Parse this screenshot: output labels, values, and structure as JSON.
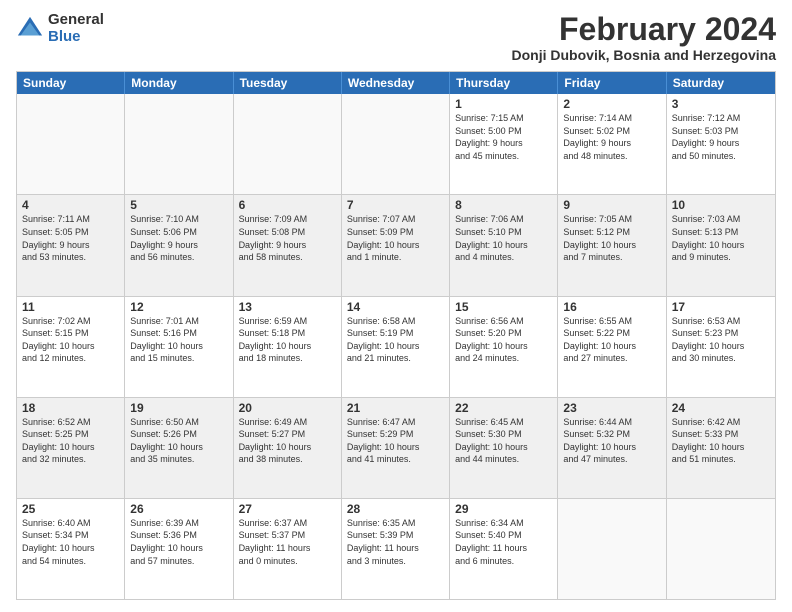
{
  "logo": {
    "general": "General",
    "blue": "Blue"
  },
  "title": "February 2024",
  "subtitle": "Donji Dubovik, Bosnia and Herzegovina",
  "days_of_week": [
    "Sunday",
    "Monday",
    "Tuesday",
    "Wednesday",
    "Thursday",
    "Friday",
    "Saturday"
  ],
  "weeks": [
    [
      {
        "day": "",
        "detail": ""
      },
      {
        "day": "",
        "detail": ""
      },
      {
        "day": "",
        "detail": ""
      },
      {
        "day": "",
        "detail": ""
      },
      {
        "day": "1",
        "detail": "Sunrise: 7:15 AM\nSunset: 5:00 PM\nDaylight: 9 hours\nand 45 minutes."
      },
      {
        "day": "2",
        "detail": "Sunrise: 7:14 AM\nSunset: 5:02 PM\nDaylight: 9 hours\nand 48 minutes."
      },
      {
        "day": "3",
        "detail": "Sunrise: 7:12 AM\nSunset: 5:03 PM\nDaylight: 9 hours\nand 50 minutes."
      }
    ],
    [
      {
        "day": "4",
        "detail": "Sunrise: 7:11 AM\nSunset: 5:05 PM\nDaylight: 9 hours\nand 53 minutes."
      },
      {
        "day": "5",
        "detail": "Sunrise: 7:10 AM\nSunset: 5:06 PM\nDaylight: 9 hours\nand 56 minutes."
      },
      {
        "day": "6",
        "detail": "Sunrise: 7:09 AM\nSunset: 5:08 PM\nDaylight: 9 hours\nand 58 minutes."
      },
      {
        "day": "7",
        "detail": "Sunrise: 7:07 AM\nSunset: 5:09 PM\nDaylight: 10 hours\nand 1 minute."
      },
      {
        "day": "8",
        "detail": "Sunrise: 7:06 AM\nSunset: 5:10 PM\nDaylight: 10 hours\nand 4 minutes."
      },
      {
        "day": "9",
        "detail": "Sunrise: 7:05 AM\nSunset: 5:12 PM\nDaylight: 10 hours\nand 7 minutes."
      },
      {
        "day": "10",
        "detail": "Sunrise: 7:03 AM\nSunset: 5:13 PM\nDaylight: 10 hours\nand 9 minutes."
      }
    ],
    [
      {
        "day": "11",
        "detail": "Sunrise: 7:02 AM\nSunset: 5:15 PM\nDaylight: 10 hours\nand 12 minutes."
      },
      {
        "day": "12",
        "detail": "Sunrise: 7:01 AM\nSunset: 5:16 PM\nDaylight: 10 hours\nand 15 minutes."
      },
      {
        "day": "13",
        "detail": "Sunrise: 6:59 AM\nSunset: 5:18 PM\nDaylight: 10 hours\nand 18 minutes."
      },
      {
        "day": "14",
        "detail": "Sunrise: 6:58 AM\nSunset: 5:19 PM\nDaylight: 10 hours\nand 21 minutes."
      },
      {
        "day": "15",
        "detail": "Sunrise: 6:56 AM\nSunset: 5:20 PM\nDaylight: 10 hours\nand 24 minutes."
      },
      {
        "day": "16",
        "detail": "Sunrise: 6:55 AM\nSunset: 5:22 PM\nDaylight: 10 hours\nand 27 minutes."
      },
      {
        "day": "17",
        "detail": "Sunrise: 6:53 AM\nSunset: 5:23 PM\nDaylight: 10 hours\nand 30 minutes."
      }
    ],
    [
      {
        "day": "18",
        "detail": "Sunrise: 6:52 AM\nSunset: 5:25 PM\nDaylight: 10 hours\nand 32 minutes."
      },
      {
        "day": "19",
        "detail": "Sunrise: 6:50 AM\nSunset: 5:26 PM\nDaylight: 10 hours\nand 35 minutes."
      },
      {
        "day": "20",
        "detail": "Sunrise: 6:49 AM\nSunset: 5:27 PM\nDaylight: 10 hours\nand 38 minutes."
      },
      {
        "day": "21",
        "detail": "Sunrise: 6:47 AM\nSunset: 5:29 PM\nDaylight: 10 hours\nand 41 minutes."
      },
      {
        "day": "22",
        "detail": "Sunrise: 6:45 AM\nSunset: 5:30 PM\nDaylight: 10 hours\nand 44 minutes."
      },
      {
        "day": "23",
        "detail": "Sunrise: 6:44 AM\nSunset: 5:32 PM\nDaylight: 10 hours\nand 47 minutes."
      },
      {
        "day": "24",
        "detail": "Sunrise: 6:42 AM\nSunset: 5:33 PM\nDaylight: 10 hours\nand 51 minutes."
      }
    ],
    [
      {
        "day": "25",
        "detail": "Sunrise: 6:40 AM\nSunset: 5:34 PM\nDaylight: 10 hours\nand 54 minutes."
      },
      {
        "day": "26",
        "detail": "Sunrise: 6:39 AM\nSunset: 5:36 PM\nDaylight: 10 hours\nand 57 minutes."
      },
      {
        "day": "27",
        "detail": "Sunrise: 6:37 AM\nSunset: 5:37 PM\nDaylight: 11 hours\nand 0 minutes."
      },
      {
        "day": "28",
        "detail": "Sunrise: 6:35 AM\nSunset: 5:39 PM\nDaylight: 11 hours\nand 3 minutes."
      },
      {
        "day": "29",
        "detail": "Sunrise: 6:34 AM\nSunset: 5:40 PM\nDaylight: 11 hours\nand 6 minutes."
      },
      {
        "day": "",
        "detail": ""
      },
      {
        "day": "",
        "detail": ""
      }
    ]
  ]
}
